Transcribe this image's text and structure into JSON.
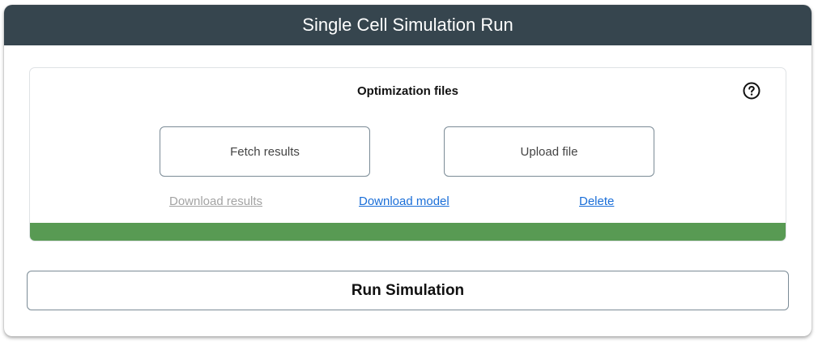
{
  "header": {
    "title": "Single Cell Simulation Run"
  },
  "optimization": {
    "title": "Optimization files",
    "help_icon": "question-circle-icon",
    "fetch_label": "Fetch results",
    "upload_label": "Upload file",
    "links": {
      "download_results": "Download results",
      "download_model": "Download model",
      "delete": "Delete"
    },
    "progress_percent": 100
  },
  "run_label": "Run Simulation",
  "colors": {
    "header_bg": "#36454e",
    "progress_fill": "#589a53",
    "link": "#1a6ed8",
    "link_disabled": "#a3a3a3"
  }
}
